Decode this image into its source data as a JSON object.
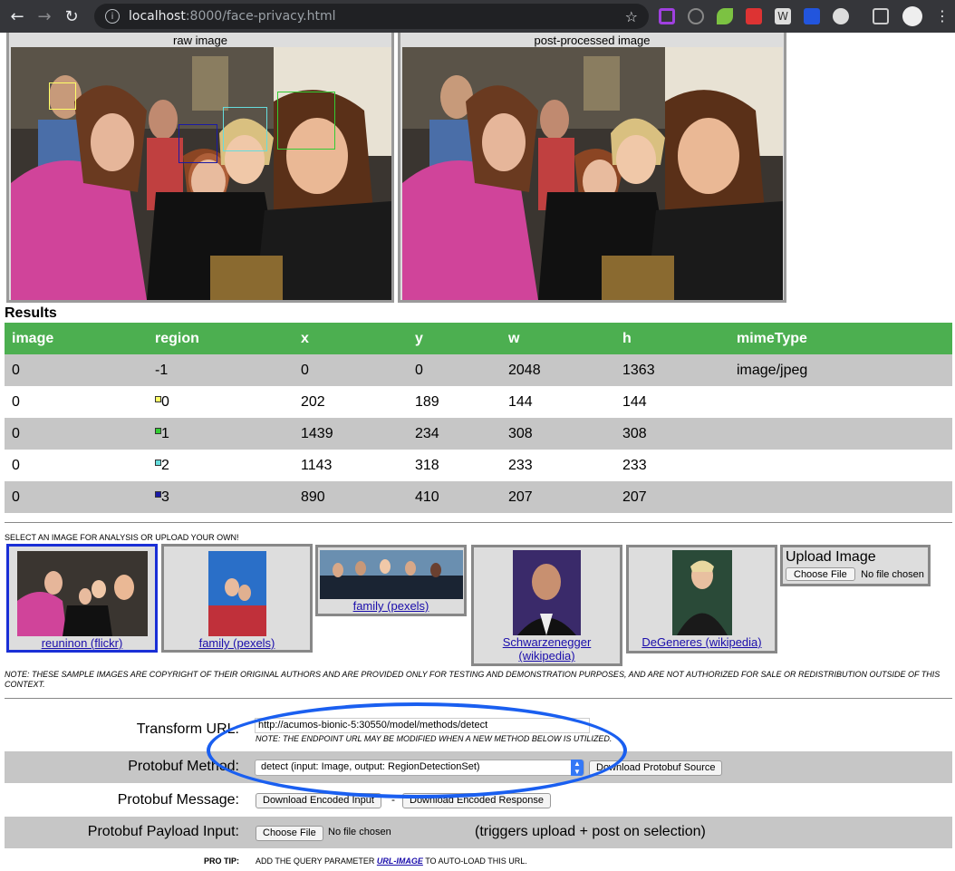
{
  "browser": {
    "url_host": "localhost",
    "url_rest": ":8000/face-privacy.html"
  },
  "panels": {
    "raw_label": "raw image",
    "processed_label": "post-processed image"
  },
  "results": {
    "title": "Results",
    "columns": [
      "image",
      "region",
      "x",
      "y",
      "w",
      "h",
      "mimeType"
    ],
    "rows": [
      {
        "image": "0",
        "region": "-1",
        "x": "0",
        "y": "0",
        "w": "2048",
        "h": "1363",
        "mimeType": "image/jpeg",
        "swatch": ""
      },
      {
        "image": "0",
        "region": "0",
        "x": "202",
        "y": "189",
        "w": "144",
        "h": "144",
        "mimeType": "",
        "swatch": "#ffff66"
      },
      {
        "image": "0",
        "region": "1",
        "x": "1439",
        "y": "234",
        "w": "308",
        "h": "308",
        "mimeType": "",
        "swatch": "#33cc33"
      },
      {
        "image": "0",
        "region": "2",
        "x": "1143",
        "y": "318",
        "w": "233",
        "h": "233",
        "mimeType": "",
        "swatch": "#66dddd"
      },
      {
        "image": "0",
        "region": "3",
        "x": "890",
        "y": "410",
        "w": "207",
        "h": "207",
        "mimeType": "",
        "swatch": "#1a1aa6"
      }
    ]
  },
  "samples": {
    "caption": "SELECT AN IMAGE FOR ANALYSIS OR UPLOAD YOUR OWN!",
    "items": [
      {
        "label": "reuninon (flickr)"
      },
      {
        "label": "family (pexels)"
      },
      {
        "label": "family (pexels)"
      },
      {
        "label": "Schwarzenegger (wikipedia)"
      },
      {
        "label": "DeGeneres (wikipedia)"
      }
    ],
    "upload_title": "Upload Image",
    "choose_file": "Choose File",
    "no_file": "No file chosen"
  },
  "copyright_note": "NOTE: THESE SAMPLE IMAGES ARE COPYRIGHT OF THEIR ORIGINAL AUTHORS AND ARE PROVIDED ONLY FOR TESTING AND DEMONSTRATION PURPOSES, AND ARE NOT AUTHORIZED FOR SALE OR REDISTRIBUTION OUTSIDE OF THIS CONTEXT.",
  "form": {
    "transform_label": "Transform URL:",
    "transform_value": "http://acumos-bionic-5:30550/model/methods/detect",
    "transform_note": "NOTE: THE ENDPOINT URL MAY BE MODIFIED WHEN A NEW METHOD BELOW IS UTILIZED.",
    "method_label": "Protobuf Method:",
    "method_value": "detect (input: Image, output: RegionDetectionSet)",
    "download_source": "Download Protobuf Source",
    "message_label": "Protobuf Message:",
    "download_input": "Download Encoded Input",
    "dash": "-",
    "download_response": "Download Encoded Response",
    "payload_label": "Protobuf Payload Input:",
    "choose_file": "Choose File",
    "no_file": "No file chosen",
    "triggers": "(triggers upload + post on selection)",
    "protip_label": "PRO TIP:",
    "protip_text_before": "ADD THE QUERY PARAMETER ",
    "protip_link": "URL-IMAGE",
    "protip_text_after": " TO AUTO-LOAD THIS URL."
  }
}
